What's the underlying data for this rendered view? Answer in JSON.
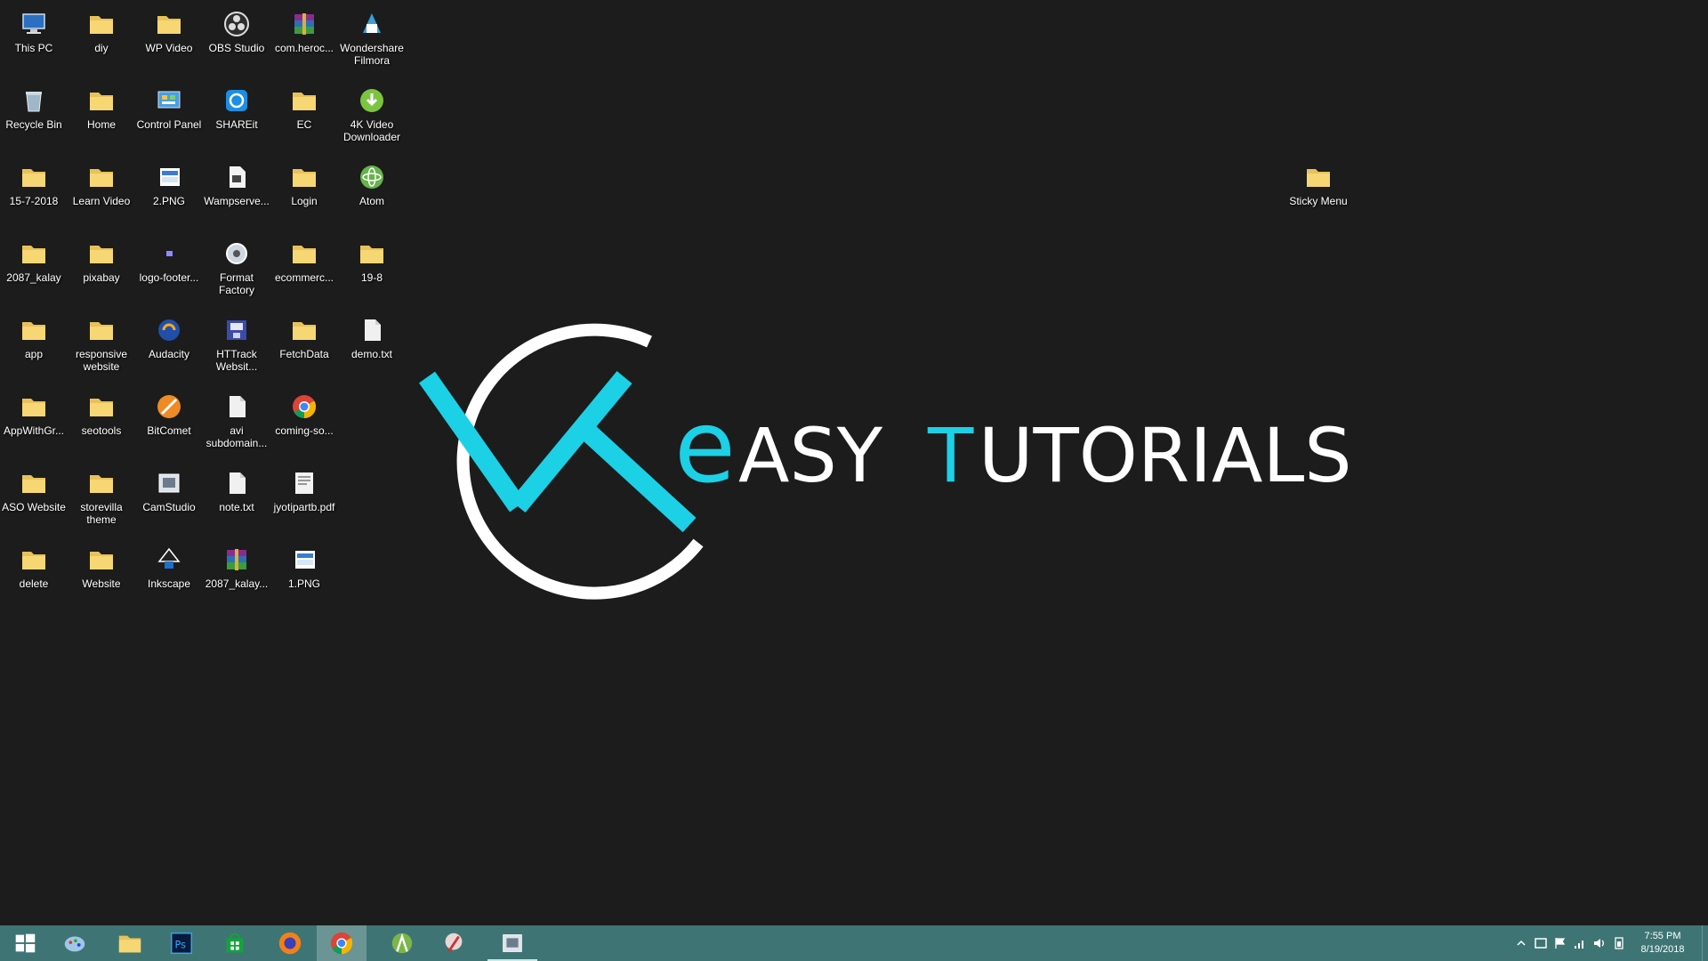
{
  "desktop": {
    "icons": [
      {
        "label": "This PC",
        "icon": "pc-icon",
        "col": 0,
        "row": 0
      },
      {
        "label": "diy",
        "icon": "folder-icon",
        "col": 1,
        "row": 0
      },
      {
        "label": "WP Video",
        "icon": "folder-icon",
        "col": 2,
        "row": 0
      },
      {
        "label": "OBS Studio",
        "icon": "obs-icon",
        "col": 3,
        "row": 0
      },
      {
        "label": "com.heroc...",
        "icon": "winrar-icon",
        "col": 4,
        "row": 0
      },
      {
        "label": "Wondershare Filmora",
        "icon": "filmora-icon",
        "col": 5,
        "row": 0
      },
      {
        "label": "Recycle Bin",
        "icon": "recycle-bin-icon",
        "col": 0,
        "row": 1
      },
      {
        "label": "Home",
        "icon": "folder-icon",
        "col": 1,
        "row": 1
      },
      {
        "label": "Control Panel",
        "icon": "control-panel-icon",
        "col": 2,
        "row": 1
      },
      {
        "label": "SHAREit",
        "icon": "shareit-icon",
        "col": 3,
        "row": 1
      },
      {
        "label": "EC",
        "icon": "folder-icon",
        "col": 4,
        "row": 1
      },
      {
        "label": "4K Video Downloader",
        "icon": "downloader-icon",
        "col": 5,
        "row": 1
      },
      {
        "label": "15-7-2018",
        "icon": "folder-icon",
        "col": 0,
        "row": 2
      },
      {
        "label": "Learn Video",
        "icon": "folder-icon",
        "col": 1,
        "row": 2
      },
      {
        "label": "2.PNG",
        "icon": "image-file-icon",
        "col": 2,
        "row": 2
      },
      {
        "label": "Wampserve...",
        "icon": "document-icon",
        "col": 3,
        "row": 2
      },
      {
        "label": "Login",
        "icon": "folder-icon",
        "col": 4,
        "row": 2
      },
      {
        "label": "Atom",
        "icon": "atom-icon",
        "col": 5,
        "row": 2
      },
      {
        "label": "2087_kalay",
        "icon": "folder-icon",
        "col": 0,
        "row": 3
      },
      {
        "label": "pixabay",
        "icon": "folder-icon",
        "col": 1,
        "row": 3
      },
      {
        "label": "logo-footer...",
        "icon": "small-image-icon",
        "col": 2,
        "row": 3
      },
      {
        "label": "Format Factory",
        "icon": "format-factory-icon",
        "col": 3,
        "row": 3
      },
      {
        "label": "ecommerc...",
        "icon": "folder-icon",
        "col": 4,
        "row": 3
      },
      {
        "label": "19-8",
        "icon": "folder-icon",
        "col": 5,
        "row": 3
      },
      {
        "label": "app",
        "icon": "folder-icon",
        "col": 0,
        "row": 4
      },
      {
        "label": "responsive website",
        "icon": "folder-icon",
        "col": 1,
        "row": 4
      },
      {
        "label": "Audacity",
        "icon": "audacity-icon",
        "col": 2,
        "row": 4
      },
      {
        "label": "HTTrack Websit...",
        "icon": "httrack-icon",
        "col": 3,
        "row": 4
      },
      {
        "label": "FetchData",
        "icon": "folder-icon",
        "col": 4,
        "row": 4
      },
      {
        "label": "demo.txt",
        "icon": "text-file-icon",
        "col": 5,
        "row": 4
      },
      {
        "label": "AppWithGr...",
        "icon": "folder-icon",
        "col": 0,
        "row": 5
      },
      {
        "label": "seotools",
        "icon": "folder-icon",
        "col": 1,
        "row": 5
      },
      {
        "label": "BitComet",
        "icon": "bitcomet-icon",
        "col": 2,
        "row": 5
      },
      {
        "label": "avi subdomain...",
        "icon": "text-file-icon",
        "col": 3,
        "row": 5
      },
      {
        "label": "coming-so...",
        "icon": "chrome-icon",
        "col": 4,
        "row": 5
      },
      {
        "label": "ASO Website",
        "icon": "folder-icon",
        "col": 0,
        "row": 6
      },
      {
        "label": "storevilla theme",
        "icon": "folder-icon",
        "col": 1,
        "row": 6
      },
      {
        "label": "CamStudio",
        "icon": "camstudio-icon",
        "col": 2,
        "row": 6
      },
      {
        "label": "note.txt",
        "icon": "text-file-icon",
        "col": 3,
        "row": 6
      },
      {
        "label": "jyotipartb.pdf",
        "icon": "pdf-icon",
        "col": 4,
        "row": 6
      },
      {
        "label": "delete",
        "icon": "folder-icon",
        "col": 0,
        "row": 7
      },
      {
        "label": "Website",
        "icon": "folder-icon",
        "col": 1,
        "row": 7
      },
      {
        "label": "Inkscape",
        "icon": "inkscape-icon",
        "col": 2,
        "row": 7
      },
      {
        "label": "2087_kalay...",
        "icon": "winrar-icon",
        "col": 3,
        "row": 7
      },
      {
        "label": "1.PNG",
        "icon": "image-file-icon",
        "col": 4,
        "row": 7
      },
      {
        "label": "Sticky Menu",
        "icon": "folder-icon",
        "col": 19,
        "row": 2
      }
    ]
  },
  "wallpaper": {
    "logo_letter_e": "e",
    "logo_text_1": "ASY ",
    "logo_letter_t": "T",
    "logo_text_2": "UTORIALS",
    "accent_color": "#1cd0e6",
    "text_color": "#ffffff"
  },
  "taskbar": {
    "color": "#3e7574",
    "buttons": [
      {
        "name": "start",
        "icon": "windows-logo-icon",
        "state": "normal"
      },
      {
        "name": "paint",
        "icon": "paint-icon",
        "state": "normal"
      },
      {
        "name": "file-explorer",
        "icon": "folder-icon",
        "state": "normal"
      },
      {
        "name": "photoshop",
        "icon": "photoshop-icon",
        "state": "normal",
        "text": "Ps"
      },
      {
        "name": "store",
        "icon": "store-icon",
        "state": "normal"
      },
      {
        "name": "firefox",
        "icon": "firefox-icon",
        "state": "normal"
      },
      {
        "name": "chrome",
        "icon": "chrome-icon",
        "state": "active"
      },
      {
        "name": "android-studio",
        "icon": "android-studio-icon",
        "state": "normal"
      },
      {
        "name": "paint-brush",
        "icon": "brush-icon",
        "state": "normal"
      },
      {
        "name": "camstudio",
        "icon": "camstudio-icon",
        "state": "open"
      }
    ],
    "tray": {
      "icons": [
        "chevron-up-icon",
        "video-icon",
        "flag-icon",
        "network-icon",
        "volume-icon",
        "battery-icon"
      ],
      "time": "7:55 PM",
      "date": "8/19/2018"
    }
  }
}
